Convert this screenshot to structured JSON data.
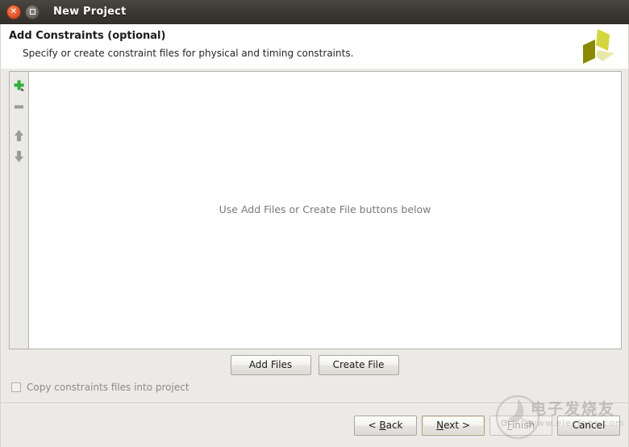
{
  "window": {
    "title": "New Project",
    "close_icon": "close-icon",
    "maximize_icon": "maximize-icon"
  },
  "header": {
    "title": "Add Constraints (optional)",
    "subtitle": "Specify or create constraint files for physical and timing constraints.",
    "logo_name": "xilinx-vivado-logo",
    "logo_colors": {
      "dark": "#8a8a00",
      "mid": "#d4d63f",
      "light": "#e8e9a8"
    }
  },
  "toolbar": {
    "add_label": "+",
    "add_icon": "add-plus-icon",
    "remove_label": "–",
    "remove_icon": "remove-minus-icon",
    "move_up_icon": "arrow-up-icon",
    "move_down_icon": "arrow-down-icon",
    "add_accent": "#2faf3d"
  },
  "file_list": {
    "placeholder": "Use Add Files or Create File buttons below",
    "items": []
  },
  "actions": {
    "add_files": "Add Files",
    "create_file": "Create File"
  },
  "options": {
    "copy_constraints_label": "Copy constraints files into project",
    "copy_constraints_checked": false,
    "copy_constraints_enabled": false
  },
  "footer": {
    "back": "< Back",
    "back_pre": "< ",
    "back_mnemonic": "B",
    "back_post": "ack",
    "next_pre": "",
    "next_mnemonic": "N",
    "next_post": "ext >",
    "finish_pre": "",
    "finish_mnemonic": "F",
    "finish_post": "inish",
    "cancel": "Cancel",
    "finish_enabled": false,
    "next_focused": true
  },
  "watermark": {
    "text_cn": "电子发烧友",
    "text_en": "www.elecfans.com",
    "logo_name": "elecfans-watermark-logo"
  }
}
